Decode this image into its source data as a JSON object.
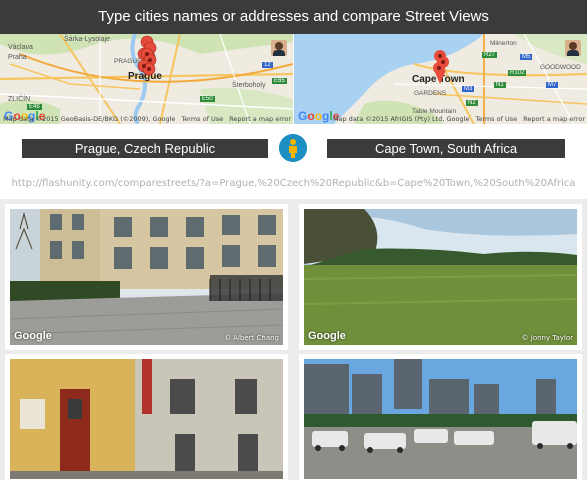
{
  "header": {
    "title": "Type cities names or addresses and compare Street Views"
  },
  "maps": {
    "left": {
      "city_label": "Prague",
      "labels": [
        "Šárka-Lysolaje",
        "Václava",
        "Praha",
        "ZLIČÍN",
        "Šterboholy",
        "PRAGUE"
      ],
      "road_badges": [
        "E50",
        "E65",
        "12",
        "4",
        "E48",
        "E55"
      ],
      "attribution": "Map data ©2015 GeoBasis-DE/BKG (©2009), Google",
      "terms": "Terms of Use",
      "report": "Report a map error"
    },
    "right": {
      "city_label": "Cape Town",
      "labels": [
        "GARDENS",
        "Table Mountain",
        "GOODWOOD",
        "Milnerton"
      ],
      "road_badges": [
        "R27",
        "M5",
        "R102",
        "N1",
        "M7",
        "M3",
        "N2"
      ],
      "attribution": "Map data ©2015 AfriGIS (Pty) Ltd, Google",
      "terms": "Terms of Use",
      "report": "Report a map error"
    },
    "google_logo": "Google"
  },
  "cities": {
    "left": "Prague, Czech Republic",
    "right": "Cape Town, South Africa"
  },
  "url": "http://flashunity.com/comparestreets/?a=Prague,%20Czech%20Republic&b=Cape%20Town,%20South%20Africa",
  "street_views": [
    {
      "google": "Google",
      "credit": "© Albert Chang"
    },
    {
      "google": "Google",
      "credit": "© Jonny Taylor"
    }
  ],
  "colors": {
    "header_bg": "#3b3b3b",
    "swap_button": "#1e8fc2",
    "marker": "#e74c3c"
  }
}
